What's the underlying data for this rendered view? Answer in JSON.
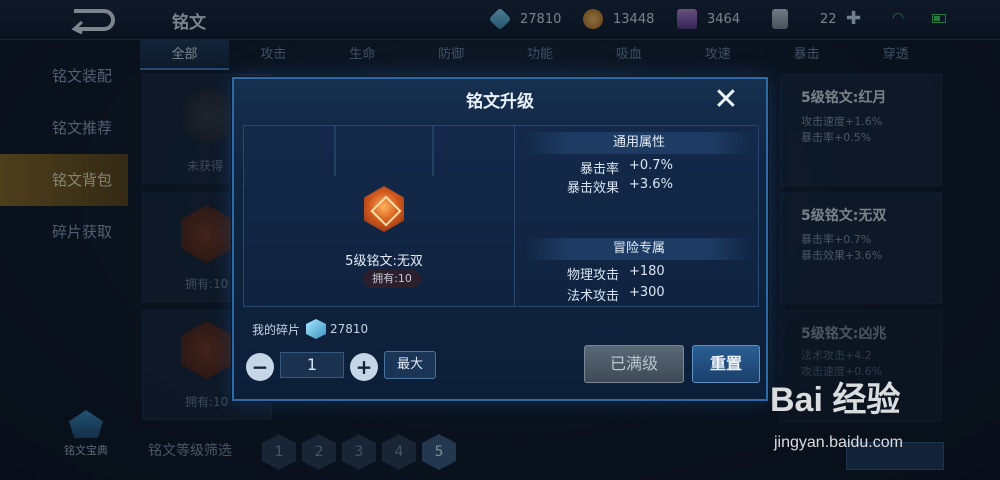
{
  "topbar": {
    "title": "铭文",
    "resources": [
      {
        "name": "crystal",
        "value": "27810"
      },
      {
        "name": "gold",
        "value": "13448"
      },
      {
        "name": "gem",
        "value": "3464"
      },
      {
        "name": "card",
        "value": "22"
      }
    ]
  },
  "tabs": [
    "全部",
    "攻击",
    "生命",
    "防御",
    "功能",
    "吸血",
    "攻速",
    "暴击",
    "穿透"
  ],
  "sidebar": {
    "items": [
      "铭文装配",
      "铭文推荐",
      "铭文背包",
      "碎片获取"
    ],
    "codex_label": "铭文宝典"
  },
  "background": {
    "unobtained": "未获得",
    "owned_1": "拥有:10",
    "owned_2": "拥有:10",
    "right_cards": [
      {
        "title": "5级铭文:红月",
        "lines": [
          "攻击速度+1.6%",
          "暴击率+0.5%"
        ]
      },
      {
        "title": "5级铭文:无双",
        "lines": [
          "暴击率+0.7%",
          "暴击效果+3.6%"
        ]
      },
      {
        "title": "5级铭文:凶兆",
        "lines": [
          "法术攻击+4.2",
          "攻击速度+0.6%"
        ]
      }
    ],
    "filter_label": "铭文等级筛选",
    "levels": [
      "1",
      "2",
      "3",
      "4",
      "5"
    ]
  },
  "modal": {
    "title": "铭文升级",
    "medal_name": "5级铭文:无双",
    "owned": "拥有:10",
    "general_header": "通用属性",
    "general_stats": [
      {
        "k": "暴击率",
        "v": "+0.7%"
      },
      {
        "k": "暴击效果",
        "v": "+3.6%"
      }
    ],
    "adventure_header": "冒险专属",
    "adventure_stats": [
      {
        "k": "物理攻击",
        "v": "+180"
      },
      {
        "k": "法术攻击",
        "v": "+300"
      }
    ],
    "fragments_label": "我的碎片",
    "fragments_value": "27810",
    "quantity": "1",
    "max_label": "最大",
    "maxed_label": "已满级",
    "reset_label": "重置"
  },
  "watermark": {
    "logo": "Bai 经验",
    "url": "jingyan.baidu.com"
  }
}
